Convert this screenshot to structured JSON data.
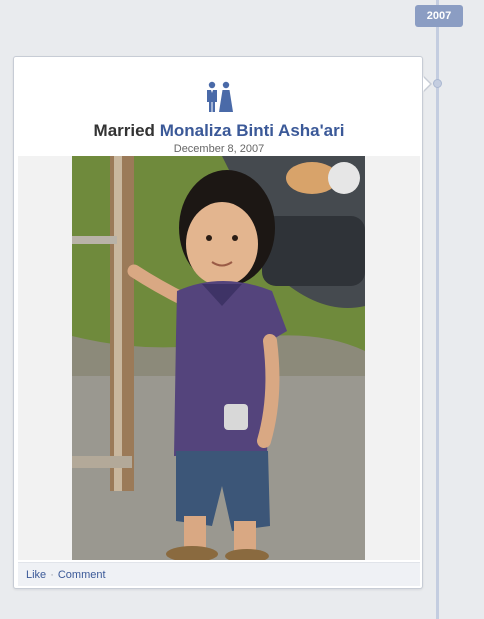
{
  "timeline": {
    "year": "2007"
  },
  "event": {
    "verb": "Married",
    "name": "Monaliza Binti Asha'ari",
    "date": "December 8, 2007",
    "icon": "couple-icon"
  },
  "actions": {
    "like": "Like",
    "separator": "·",
    "comment": "Comment"
  },
  "colors": {
    "link": "#3b5998",
    "badge": "#8b9dc3",
    "background": "#e9ebee",
    "timeline": "#c4cde0"
  }
}
